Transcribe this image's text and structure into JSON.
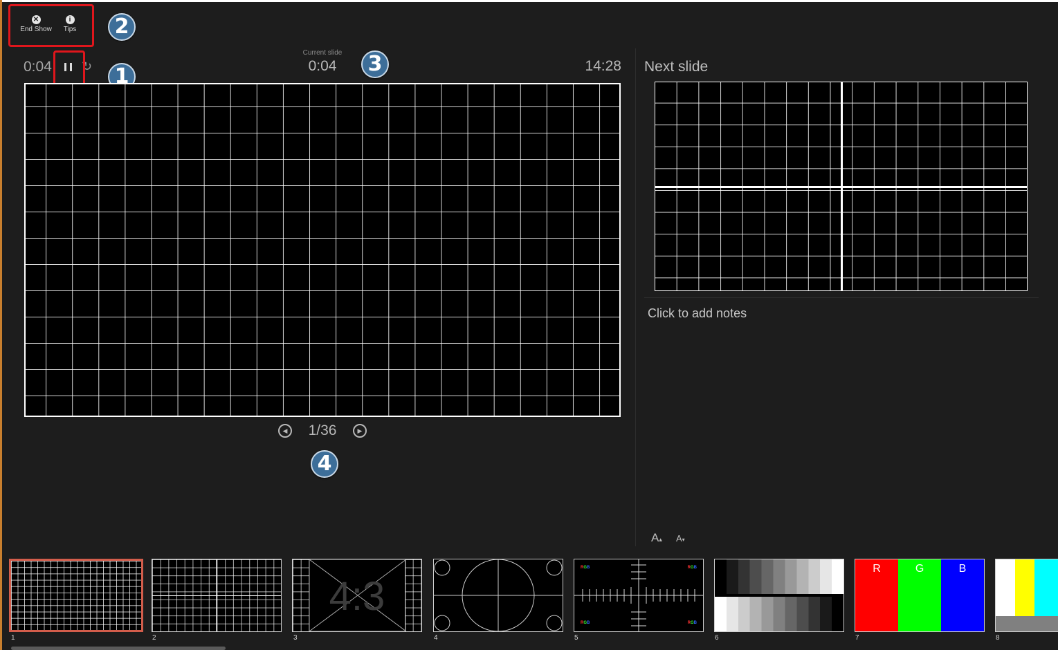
{
  "toolbar": {
    "end_show_label": "End Show",
    "tips_label": "Tips",
    "end_show_icon": "close-circle-icon",
    "tips_icon": "info-circle-icon"
  },
  "annotations": {
    "one": "1",
    "two": "2",
    "three": "3",
    "four": "4"
  },
  "timers": {
    "elapsed": "0:04",
    "current_slide_label": "Current slide",
    "current_slide_time": "0:04",
    "clock": "14:28"
  },
  "navigation": {
    "slide_counter": "1/36"
  },
  "next_panel": {
    "title": "Next slide",
    "notes_placeholder": "Click to add notes"
  },
  "font_controls": {
    "increase": "A",
    "decrease": "A"
  },
  "thumbnails": [
    {
      "number": "1",
      "selected": true
    },
    {
      "number": "2"
    },
    {
      "number": "3",
      "overlay_text": "4:3"
    },
    {
      "number": "4"
    },
    {
      "number": "5",
      "rgb_label": "RGB"
    },
    {
      "number": "6"
    },
    {
      "number": "7",
      "r": "R",
      "g": "G",
      "b": "B"
    },
    {
      "number": "8"
    }
  ],
  "colors": {
    "background": "#1d1d1d",
    "highlight_red": "#e0161c",
    "badge_blue": "#3d6e99",
    "selected_thumb": "#d35d4b"
  }
}
